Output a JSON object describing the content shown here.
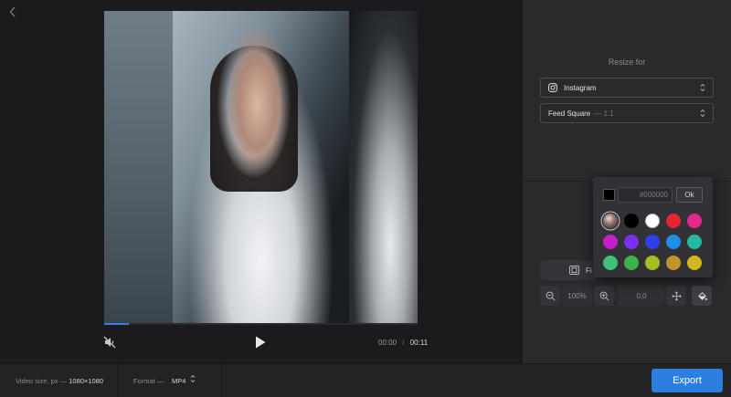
{
  "editor": {
    "playback": {
      "current_time": "00:00",
      "separator": "/",
      "duration": "00:11",
      "progress": 0.08
    }
  },
  "panel": {
    "heading": "Resize for",
    "platform_select": {
      "value": "Instagram",
      "icon": "instagram-icon"
    },
    "size_select": {
      "value": "Feed Square",
      "ratio": "— 1:1"
    },
    "fit_button": {
      "label": "Fi",
      "icon": "fit-frame-icon"
    },
    "zoom": {
      "value": "100%"
    },
    "position": {
      "value": "0,0"
    },
    "icons": [
      "zoom-out-icon",
      "zoom-in-icon",
      "move-icon",
      "paint-bucket-icon"
    ]
  },
  "color_picker": {
    "hex_placeholder": "#000000",
    "current_color": "#000000",
    "ok_label": "Ok",
    "swatches": [
      "gradient",
      "#000000",
      "#ffffff",
      "#e32636",
      "#e6288a",
      "#c21ecb",
      "#7b2ff0",
      "#2f3ff0",
      "#1e90ea",
      "#23b8a0",
      "#3cc07a",
      "#3ab449",
      "#a4c21f",
      "#c1942a",
      "#d4b61e"
    ]
  },
  "bottom_bar": {
    "video_size_label": "Video size, px —",
    "video_size_value": "1080×1080",
    "format_label": "Format —",
    "format_value": "MP4",
    "export_label": "Export"
  },
  "colors": {
    "accent": "#2b7fe0",
    "background": "#1c1c1f",
    "panel": "#2a2a2d"
  }
}
